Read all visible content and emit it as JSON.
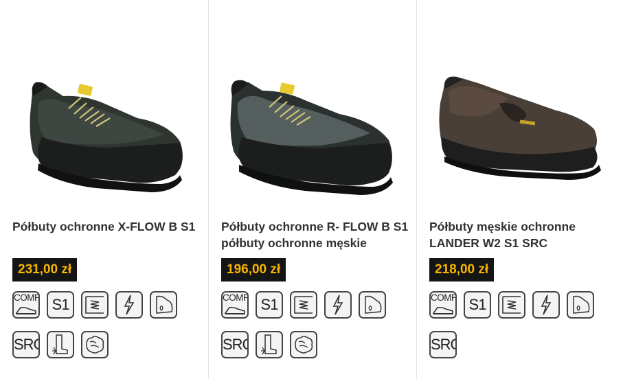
{
  "products": [
    {
      "title": "Półbuty ochronne X-FLOW B S1",
      "price": "231,00 zł",
      "shoe_color": "#2f3630",
      "upper_color": "#3e4842",
      "badges": [
        "comp-toecap-icon",
        "s1-badge",
        "antistatic-insole-icon",
        "antistatic-icon",
        "heel-energy-absorption-icon",
        "src-badge",
        "oil-resistant-sole-icon",
        "breathable-icon"
      ]
    },
    {
      "title": "Półbuty ochronne R- FLOW B S1 półbuty ochronne męskie",
      "price": "196,00 zł",
      "shoe_color": "#2a3130",
      "upper_color": "#55605e",
      "badges": [
        "comp-toecap-icon",
        "s1-badge",
        "antistatic-insole-icon",
        "antistatic-icon",
        "heel-energy-absorption-icon",
        "src-badge",
        "oil-resistant-sole-icon",
        "breathable-icon"
      ]
    },
    {
      "title": "Półbuty męskie ochronne LANDER W2 S1 SRC",
      "price": "218,00 zł",
      "shoe_color": "#4a3f37",
      "upper_color": "#5a4a40",
      "badges": [
        "comp-toecap-icon",
        "s1-badge",
        "antistatic-insole-icon",
        "antistatic-icon",
        "heel-energy-absorption-icon",
        "src-badge"
      ]
    }
  ],
  "badge_labels": {
    "comp": "COMP",
    "s1": "S1",
    "src": "SRC"
  },
  "colors": {
    "price_bg": "#151515",
    "price_text": "#f7b500",
    "divider": "#e3e3e3"
  }
}
